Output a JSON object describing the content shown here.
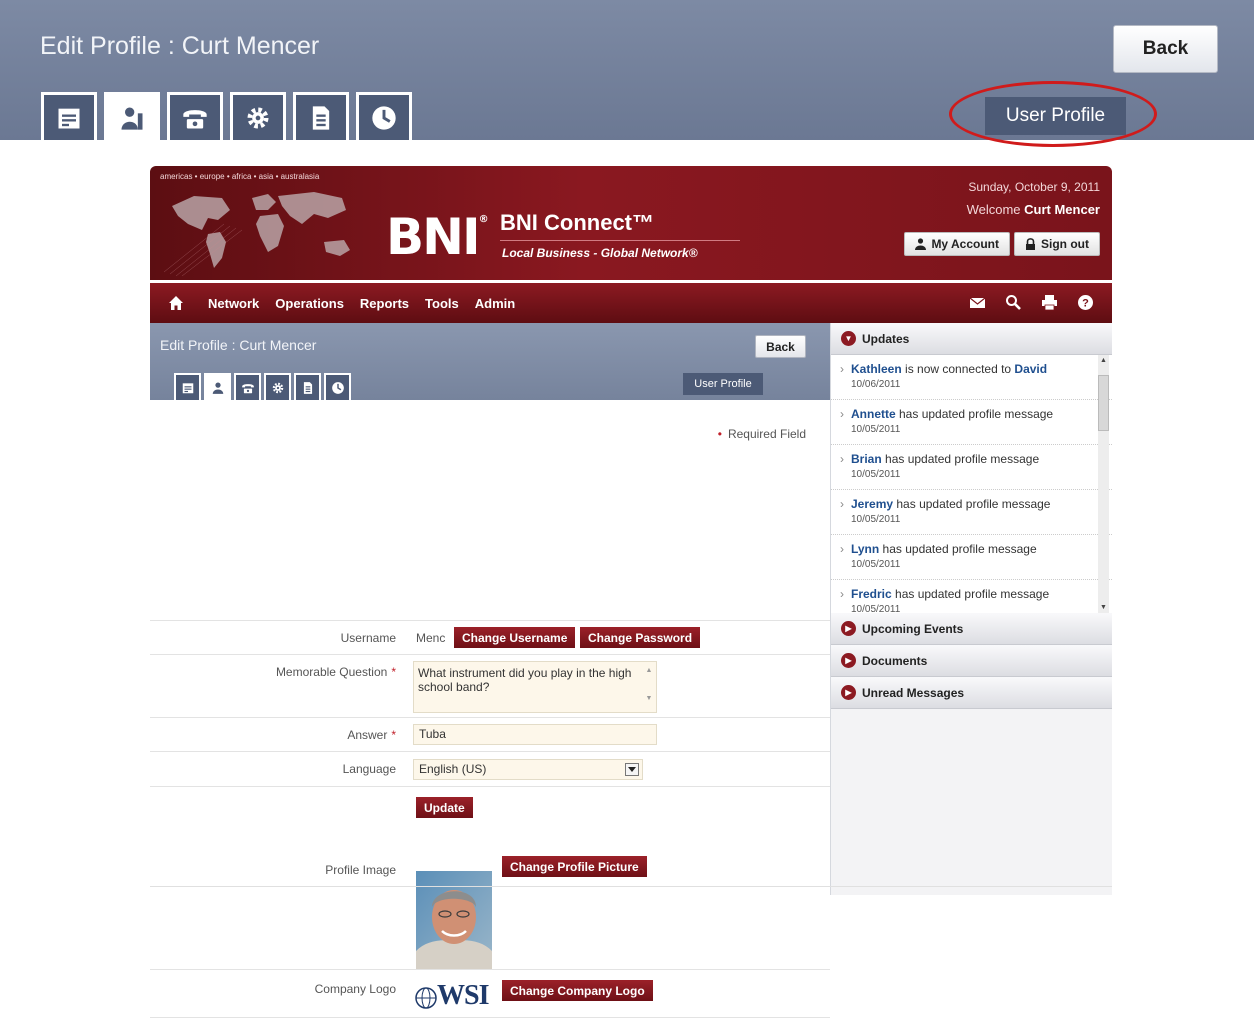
{
  "zoom": {
    "title": "Edit Profile : Curt Mencer",
    "back_label": "Back",
    "user_profile_label": "User Profile",
    "tabs": [
      "list-icon",
      "user-profile-icon",
      "phone-icon",
      "gear-icon",
      "document-icon",
      "clock-icon"
    ],
    "active_tab": 1,
    "highlight_color": "#d01b1b"
  },
  "header": {
    "regions": "americas • europe • africa • asia • australasia",
    "logo": "BNI",
    "logo_reg": "®",
    "brand_title": "BNI Connect™",
    "tagline": "Local Business - Global Network®",
    "date": "Sunday, October 9, 2011",
    "welcome_prefix": "Welcome",
    "welcome_name": "Curt Mencer",
    "my_account_label": "My Account",
    "sign_out_label": "Sign out",
    "brand_color": "#8a1820"
  },
  "nav": {
    "items": [
      "Network",
      "Operations",
      "Reports",
      "Tools",
      "Admin"
    ],
    "icons": [
      "home-icon",
      "mail-icon",
      "search-icon",
      "print-icon",
      "help-icon"
    ]
  },
  "content": {
    "title": "Edit Profile : Curt Mencer",
    "back_label": "Back",
    "user_profile_label": "User Profile",
    "required_note": "Required Field",
    "required_star": "•",
    "form": {
      "username_label": "Username",
      "username_value": "Menc",
      "change_username_label": "Change Username",
      "change_password_label": "Change Password",
      "question_label": "Memorable Question",
      "question_value": "What instrument did you play in the high school band?",
      "answer_label": "Answer",
      "answer_value": "Tuba",
      "language_label": "Language",
      "language_value": "English (US)",
      "update_label": "Update",
      "profile_image_label": "Profile Image",
      "change_picture_label": "Change Profile Picture",
      "company_logo_label": "Company Logo",
      "company_logo_text": "WSI",
      "change_logo_label": "Change Company Logo",
      "required_star": "*"
    }
  },
  "sidebar": {
    "updates_title": "Updates",
    "updates": [
      {
        "name": "Kathleen",
        "text": " is now connected to ",
        "target": "David",
        "date": "10/06/2011"
      },
      {
        "name": "Annette",
        "text": " has updated profile message",
        "target": "",
        "date": "10/05/2011"
      },
      {
        "name": "Brian",
        "text": " has updated profile message",
        "target": "",
        "date": "10/05/2011"
      },
      {
        "name": "Jeremy",
        "text": " has updated profile message",
        "target": "",
        "date": "10/05/2011"
      },
      {
        "name": "Lynn",
        "text": " has updated profile message",
        "target": "",
        "date": "10/05/2011"
      },
      {
        "name": "Fredric",
        "text": " has updated profile message",
        "target": "",
        "date": "10/05/2011"
      }
    ],
    "sections": [
      "Upcoming Events",
      "Documents",
      "Unread Messages"
    ]
  }
}
